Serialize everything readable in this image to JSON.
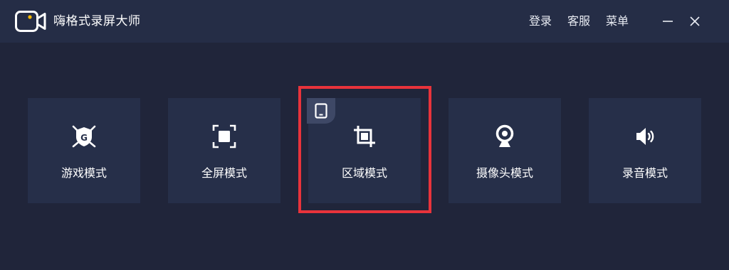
{
  "app": {
    "title": "嗨格式录屏大师",
    "logo_icon": "video-camera-icon",
    "accent_color": "#f5b800"
  },
  "header": {
    "login_label": "登录",
    "service_label": "客服",
    "menu_label": "菜单",
    "minimize_icon": "minimize-icon",
    "close_icon": "close-icon"
  },
  "modes": [
    {
      "label": "游戏模式",
      "icon": "gamepad-shield-icon"
    },
    {
      "label": "全屏模式",
      "icon": "fullscreen-icon"
    },
    {
      "label": "区域模式",
      "icon": "crop-icon",
      "selected": true,
      "badge_icon": "tablet-icon"
    },
    {
      "label": "摄像头模式",
      "icon": "webcam-icon"
    },
    {
      "label": "录音模式",
      "icon": "speaker-icon"
    }
  ],
  "colors": {
    "background": "#20253a",
    "titlebar": "#252d46",
    "card": "#262f49",
    "highlight": "#e8333b"
  }
}
